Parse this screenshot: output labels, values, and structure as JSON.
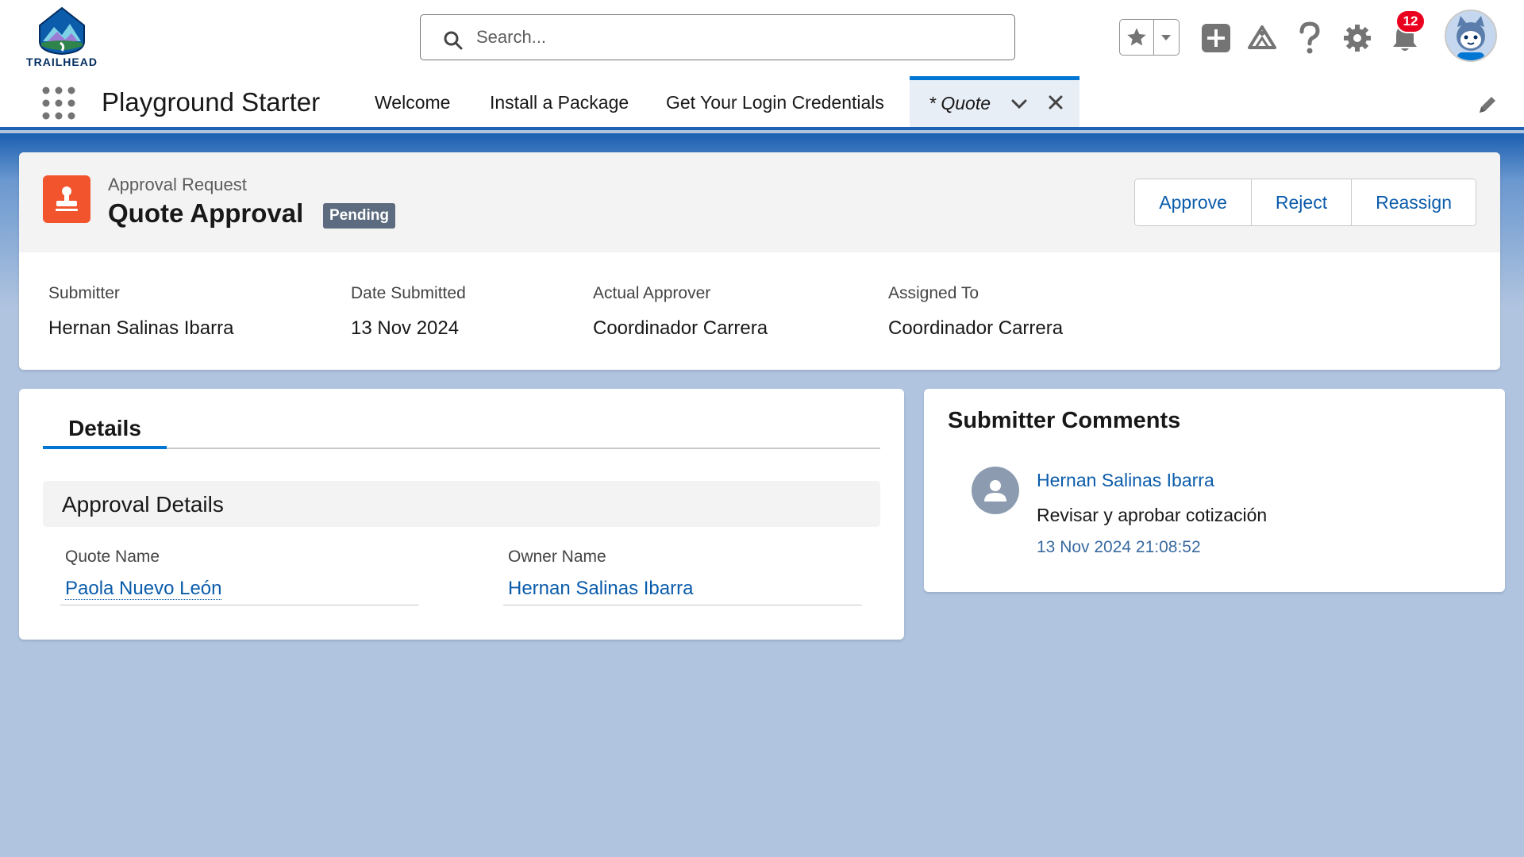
{
  "header": {
    "logo_text": "TRAILHEAD",
    "search_placeholder": "Search...",
    "notification_count": "12"
  },
  "nav": {
    "app_name": "Playground Starter",
    "items": [
      {
        "label": "Welcome"
      },
      {
        "label": "Install a Package"
      },
      {
        "label": "Get Your Login Credentials"
      }
    ],
    "active_tab": {
      "label": "* Quote"
    }
  },
  "record": {
    "type": "Approval Request",
    "title": "Quote Approval",
    "status": "Pending",
    "actions": {
      "approve": "Approve",
      "reject": "Reject",
      "reassign": "Reassign"
    },
    "highlights": [
      {
        "label": "Submitter",
        "value": "Hernan Salinas Ibarra"
      },
      {
        "label": "Date Submitted",
        "value": "13 Nov 2024"
      },
      {
        "label": "Actual Approver",
        "value": "Coordinador Carrera"
      },
      {
        "label": "Assigned To",
        "value": "Coordinador Carrera"
      }
    ]
  },
  "details": {
    "tab_label": "Details",
    "section_title": "Approval Details",
    "fields": [
      {
        "label": "Quote Name",
        "value": "Paola Nuevo León"
      },
      {
        "label": "Owner Name",
        "value": "Hernan Salinas Ibarra"
      }
    ]
  },
  "comments": {
    "title": "Submitter Comments",
    "author": "Hernan Salinas Ibarra",
    "text": "Revisar y aprobar cotización",
    "timestamp": "13 Nov 2024 21:08:52"
  },
  "colors": {
    "brand_blue": "#0176d3",
    "link_blue": "#0b5cab",
    "record_icon": "#f2542d",
    "status_pill": "#5c6b7f",
    "notification_badge": "#ea001e"
  }
}
